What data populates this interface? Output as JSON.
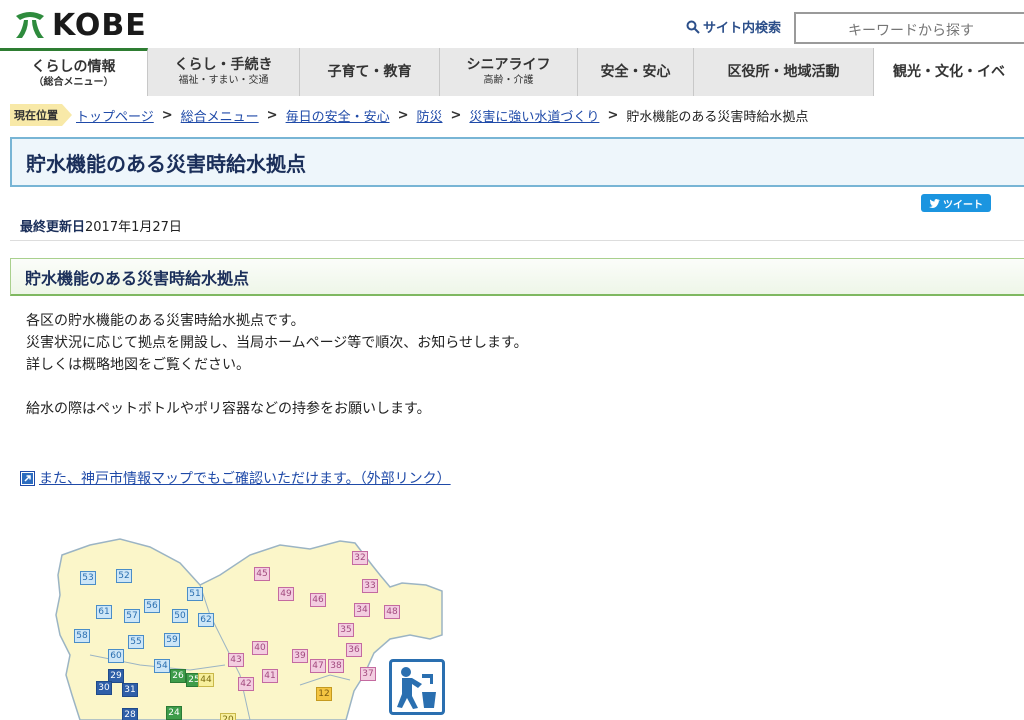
{
  "header": {
    "logo_text": "KOBE",
    "search_label": "サイト内検索",
    "search_placeholder": "キーワードから探す"
  },
  "nav": {
    "items": [
      {
        "main": "くらしの情報",
        "sub": "（総合メニュー）"
      },
      {
        "main": "くらし・手続き",
        "sub": "福祉・すまい・交通"
      },
      {
        "main": "子育て・教育",
        "sub": ""
      },
      {
        "main": "シニアライフ",
        "sub": "高齢・介護"
      },
      {
        "main": "安全・安心",
        "sub": ""
      },
      {
        "main": "区役所・地域活動",
        "sub": ""
      },
      {
        "main": "観光・文化・イベ",
        "sub": ""
      }
    ]
  },
  "breadcrumb": {
    "badge": "現在位置",
    "links": [
      "トップページ",
      "総合メニュー",
      "毎日の安全・安心",
      "防災",
      "災害に強い水道づくり"
    ],
    "current": "貯水機能のある災害時給水拠点"
  },
  "page": {
    "title": "貯水機能のある災害時給水拠点",
    "tweet_label": "ツイート",
    "updated_label": "最終更新日",
    "updated_date": "2017年1月27日",
    "section_title": "貯水機能のある災害時給水拠点",
    "paragraphs": [
      "各区の貯水機能のある災害時給水拠点です。",
      "災害状況に応じて拠点を開設し、当局ホームページ等で順次、お知らせします。",
      "詳しくは概略地図をご覧ください。",
      "給水の際はペットボトルやポリ容器などの持参をお願いします。"
    ],
    "external_link": "また、神戸市情報マップでもご確認いただけます。（外部リンク）"
  },
  "map": {
    "colors": {
      "base": "#fbf6c9",
      "border": "#9bb4c4",
      "blue": "#cde6f7",
      "pink": "#f3cde0",
      "darkblue": "#2f5fa8",
      "green": "#3e9c4a",
      "orange": "#f4c542"
    },
    "markers": {
      "m53": "53",
      "m52": "52",
      "m51": "51",
      "m61": "61",
      "m57": "57",
      "m56": "56",
      "m50": "50",
      "m62": "62",
      "m58": "58",
      "m55": "55",
      "m59": "59",
      "m60": "60",
      "m54": "54",
      "m29": "29",
      "m26": "26",
      "m25": "25",
      "m44": "44",
      "m30": "30",
      "m31": "31",
      "m28": "28",
      "m24": "24",
      "m45": "45",
      "m32": "32",
      "m33": "33",
      "m49": "49",
      "m46": "46",
      "m34": "34",
      "m48": "48",
      "m35": "35",
      "m40": "40",
      "m43": "43",
      "m36": "36",
      "m39": "39",
      "m47": "47",
      "m38": "38",
      "m41": "41",
      "m42": "42",
      "m37": "37",
      "m12": "12",
      "m20": "20"
    },
    "icon": "water-supply-icon"
  }
}
